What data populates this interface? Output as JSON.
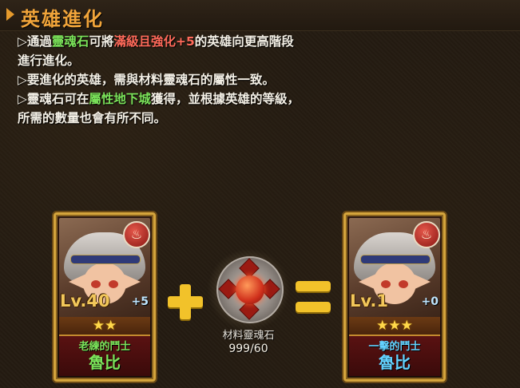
{
  "section": {
    "title": "英雄進化"
  },
  "description": {
    "line1_prefix": "▷通過",
    "line1_hl_stone": "靈魂石",
    "line1_mid": "可將",
    "line1_hl_cond": "滿級且強化+5",
    "line1_suffix": "的英雄向更高階段",
    "line2": "進行進化。",
    "line3": "▷要進化的英雄，需與材料靈魂石的屬性一致。",
    "line4_prefix": "▷靈魂石可在",
    "line4_hl_dungeon": "屬性地下城",
    "line4_suffix": "獲得，並根據英雄的等級，",
    "line5": "所需的數量也會有所不同。"
  },
  "source_hero": {
    "level": "Lv.40",
    "enhance": "+5",
    "stars": "★★",
    "star_count": 2,
    "title": "老練的鬥士",
    "name": "魯比",
    "element_icon": "fire-element-icon"
  },
  "material": {
    "label": "材料靈魂石",
    "count": "999/60"
  },
  "result_hero": {
    "level": "Lv.1",
    "enhance": "+0",
    "stars": "★★★",
    "star_count": 3,
    "title": "一擊的鬥士",
    "name": "魯比",
    "element_icon": "fire-element-icon"
  },
  "colors": {
    "title": "#f0a43a",
    "highlight_green": "#7be35a",
    "highlight_red": "#ff6a5a",
    "result_name": "#63d2ff",
    "operator": "#f2c22a"
  }
}
